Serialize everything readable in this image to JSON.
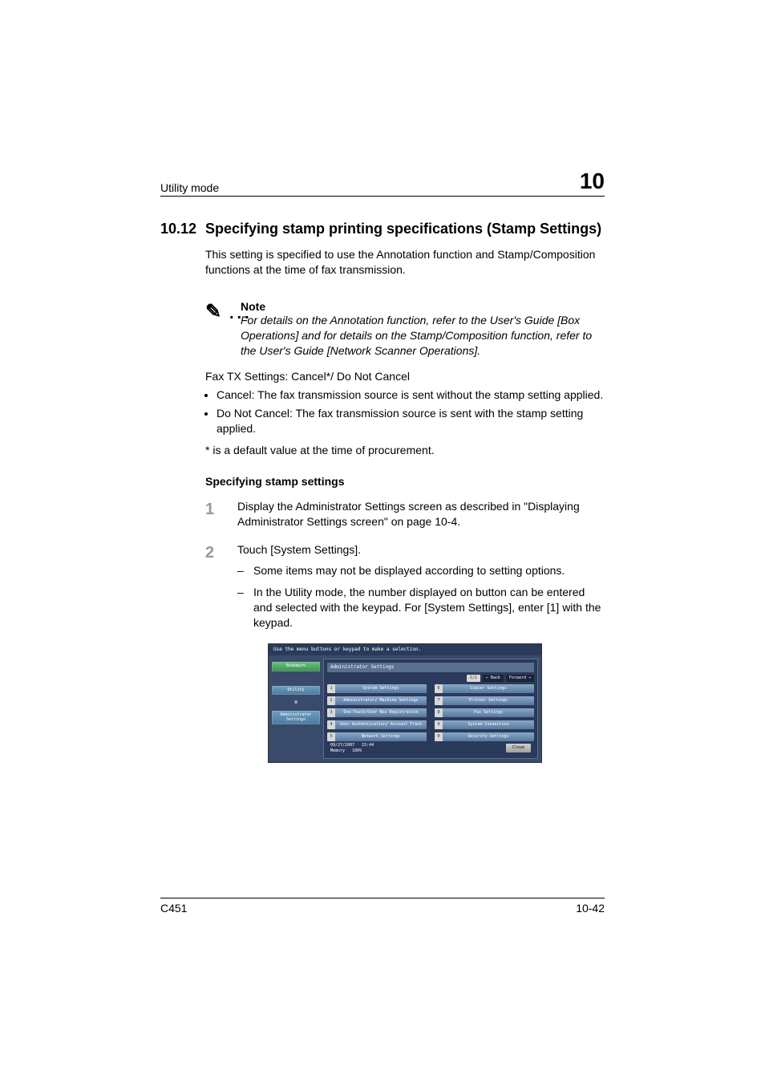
{
  "header": {
    "breadcrumb": "Utility mode",
    "chapter_num": "10"
  },
  "section": {
    "number": "10.12",
    "title": "Specifying stamp printing specifications (Stamp Settings)"
  },
  "intro": "This setting is specified to use the Annotation function and Stamp/Composition functions at the time of fax transmission.",
  "note": {
    "label": "Note",
    "body": "For details on the Annotation function, refer to the User's Guide [Box Operations] and for details on the Stamp/Composition function, refer to the User's Guide [Network Scanner Operations]."
  },
  "fax_line": "Fax TX Settings: Cancel*/ Do Not Cancel",
  "bullets": [
    "Cancel: The fax transmission source is sent without the stamp setting applied.",
    "Do Not Cancel: The fax transmission source is sent with the stamp setting applied."
  ],
  "asterisk": "* is a default value at the time of procurement.",
  "sub_heading": "Specifying stamp settings",
  "steps": [
    {
      "num": "1",
      "text": "Display the Administrator Settings screen as described in \"Displaying Administrator Settings screen\" on page 10-4.",
      "subs": []
    },
    {
      "num": "2",
      "text": "Touch [System Settings].",
      "subs": [
        "Some items may not be displayed according to setting options.",
        "In the Utility mode, the number displayed on button can be entered and selected with the keypad. For [System Settings], enter [1] with the keypad."
      ]
    }
  ],
  "screenshot": {
    "top_instruction": "Use the menu buttons or keypad to make a selection.",
    "left": {
      "bookmark": "Bookmark",
      "utility": "Utility",
      "admin": "Administrator Settings"
    },
    "panel_title": "Administrator Settings",
    "page_indicator": "1/2",
    "back_label": "Back",
    "forward_label": "Forward",
    "items": [
      {
        "n": "1",
        "label": "System Settings"
      },
      {
        "n": "2",
        "label": "Administrator/ Machine Settings"
      },
      {
        "n": "3",
        "label": "One-Touch/User Box Registration"
      },
      {
        "n": "4",
        "label": "User Authentication/ Account Track"
      },
      {
        "n": "5",
        "label": "Network Settings"
      },
      {
        "n": "6",
        "label": "Copier Settings"
      },
      {
        "n": "7",
        "label": "Printer Settings"
      },
      {
        "n": "8",
        "label": "Fax Settings"
      },
      {
        "n": "9",
        "label": "System Connection"
      },
      {
        "n": "0",
        "label": "Security Settings"
      }
    ],
    "footer": {
      "date": "09/27/2007",
      "time": "15:44",
      "memory_label": "Memory",
      "memory_value": "100%",
      "close": "Close"
    }
  },
  "footer": {
    "left": "C451",
    "right": "10-42"
  }
}
